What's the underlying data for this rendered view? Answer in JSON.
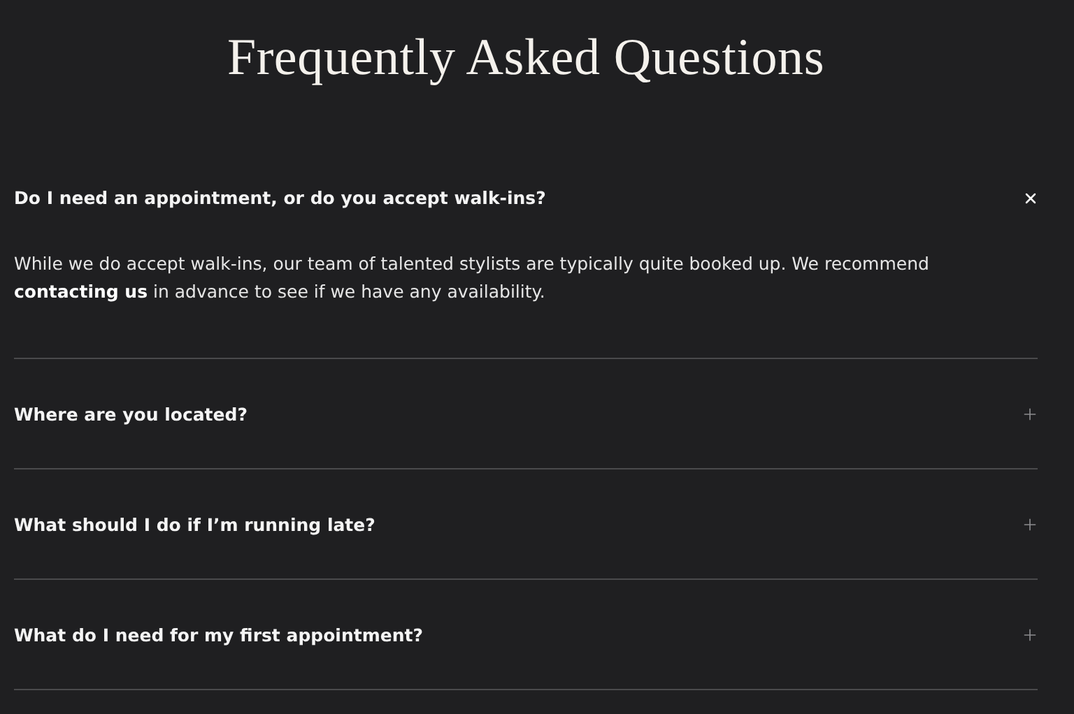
{
  "title": "Frequently Asked Questions",
  "faq": [
    {
      "question": "Do I need an appointment, or do you accept walk-ins?",
      "expanded": true,
      "answer": "While we do accept walk-ins, our team of talented stylists are typically quite booked up. We recommend **contacting us** in advance to see if we have any availability."
    },
    {
      "question": "Where are you located?",
      "expanded": false
    },
    {
      "question": "What should I do if I’m running late?",
      "expanded": false
    },
    {
      "question": "What do I need for my first appointment?",
      "expanded": false
    }
  ]
}
